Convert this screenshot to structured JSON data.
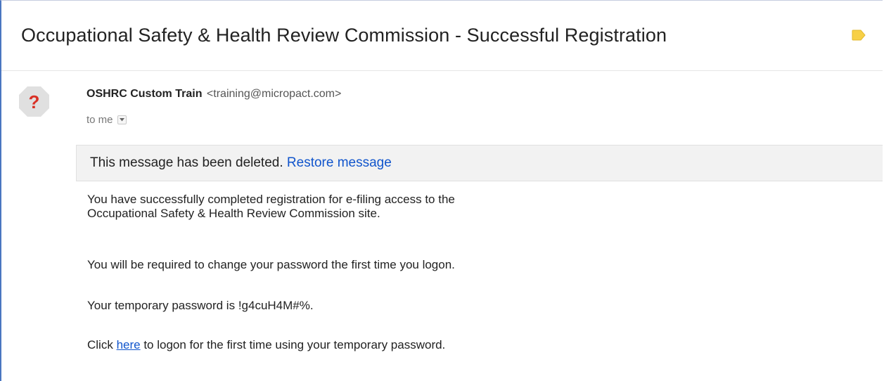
{
  "email": {
    "subject": "Occupational Safety & Health Review Commission - Successful Registration",
    "label_color": "#f7d046",
    "sender": {
      "name": "OSHRC Custom Train",
      "email": "<training@micropact.com>",
      "avatar_icon": "question-mark-icon",
      "avatar_color": "#e0e0e0",
      "avatar_mark_color": "#d93025"
    },
    "recipient_text": "to me",
    "deleted_notice": {
      "text": "This message has been deleted.",
      "restore_label": "Restore message"
    },
    "body": {
      "para1_line1": "You have successfully completed registration for e-filing access to the",
      "para1_line2": "Occupational Safety & Health Review Commission site.",
      "para2": "You will be required to change your password the first time you logon.",
      "para3_prefix": "Your temporary password is ",
      "para3_password": "!g4cuH4M#%.",
      "para4_prefix": "Click ",
      "para4_link": "here",
      "para4_suffix": " to logon for the first time using your temporary password."
    }
  }
}
